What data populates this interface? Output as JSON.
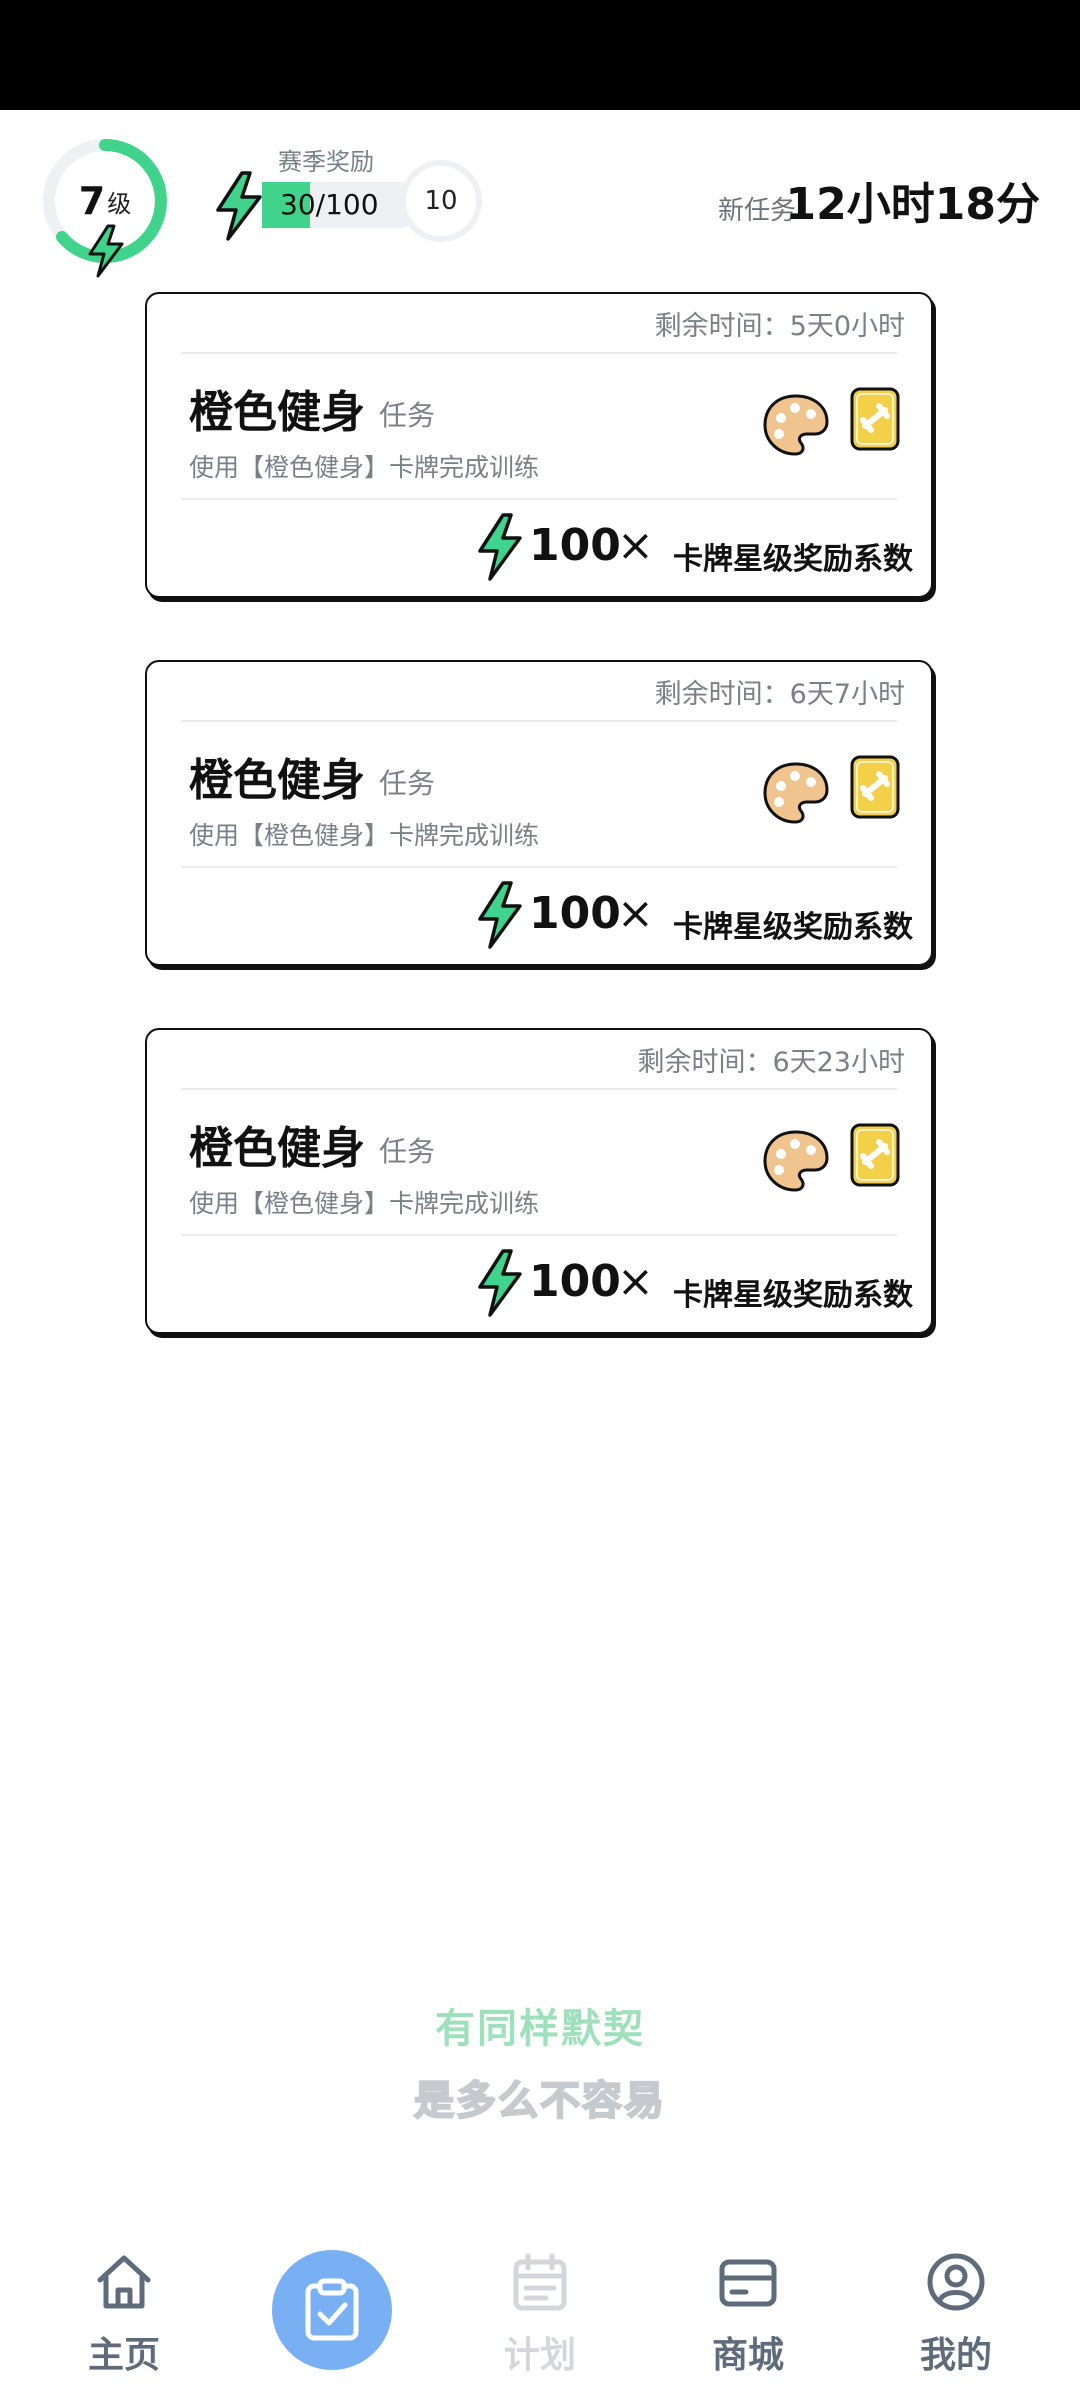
{
  "header": {
    "level_number": "7",
    "level_unit": "级",
    "season_title": "赛季奖励",
    "season_progress_text": "30/100",
    "season_progress_fraction": 0.3,
    "season_badge": "10",
    "new_task_label": "新任务",
    "new_task_time": "12小时18分"
  },
  "tasks": [
    {
      "remaining": "剩余时间：5天0小时",
      "title": "橙色健身",
      "tag": "任务",
      "description": "使用【橙色健身】卡牌完成训练",
      "reward_amount": "100",
      "reward_times": "×",
      "reward_label": "卡牌星级奖励系数"
    },
    {
      "remaining": "剩余时间：6天7小时",
      "title": "橙色健身",
      "tag": "任务",
      "description": "使用【橙色健身】卡牌完成训练",
      "reward_amount": "100",
      "reward_times": "×",
      "reward_label": "卡牌星级奖励系数"
    },
    {
      "remaining": "剩余时间：6天23小时",
      "title": "橙色健身",
      "tag": "任务",
      "description": "使用【橙色健身】卡牌完成训练",
      "reward_amount": "100",
      "reward_times": "×",
      "reward_label": "卡牌星级奖励系数"
    }
  ],
  "slogan": {
    "line1": "有同样默契",
    "line2": "是多么不容易"
  },
  "nav": {
    "items": [
      {
        "label": "主页",
        "icon": "home-icon"
      },
      {
        "label": "",
        "icon": "clipboard-check-icon"
      },
      {
        "label": "计划",
        "icon": "calendar-icon"
      },
      {
        "label": "商城",
        "icon": "card-icon"
      },
      {
        "label": "我的",
        "icon": "user-icon"
      }
    ]
  },
  "colors": {
    "accent_green": "#3fd38b",
    "nav_center_blue": "#79b0f4",
    "card_yellow": "#f2d04a",
    "palette_tan": "#efc48e"
  }
}
